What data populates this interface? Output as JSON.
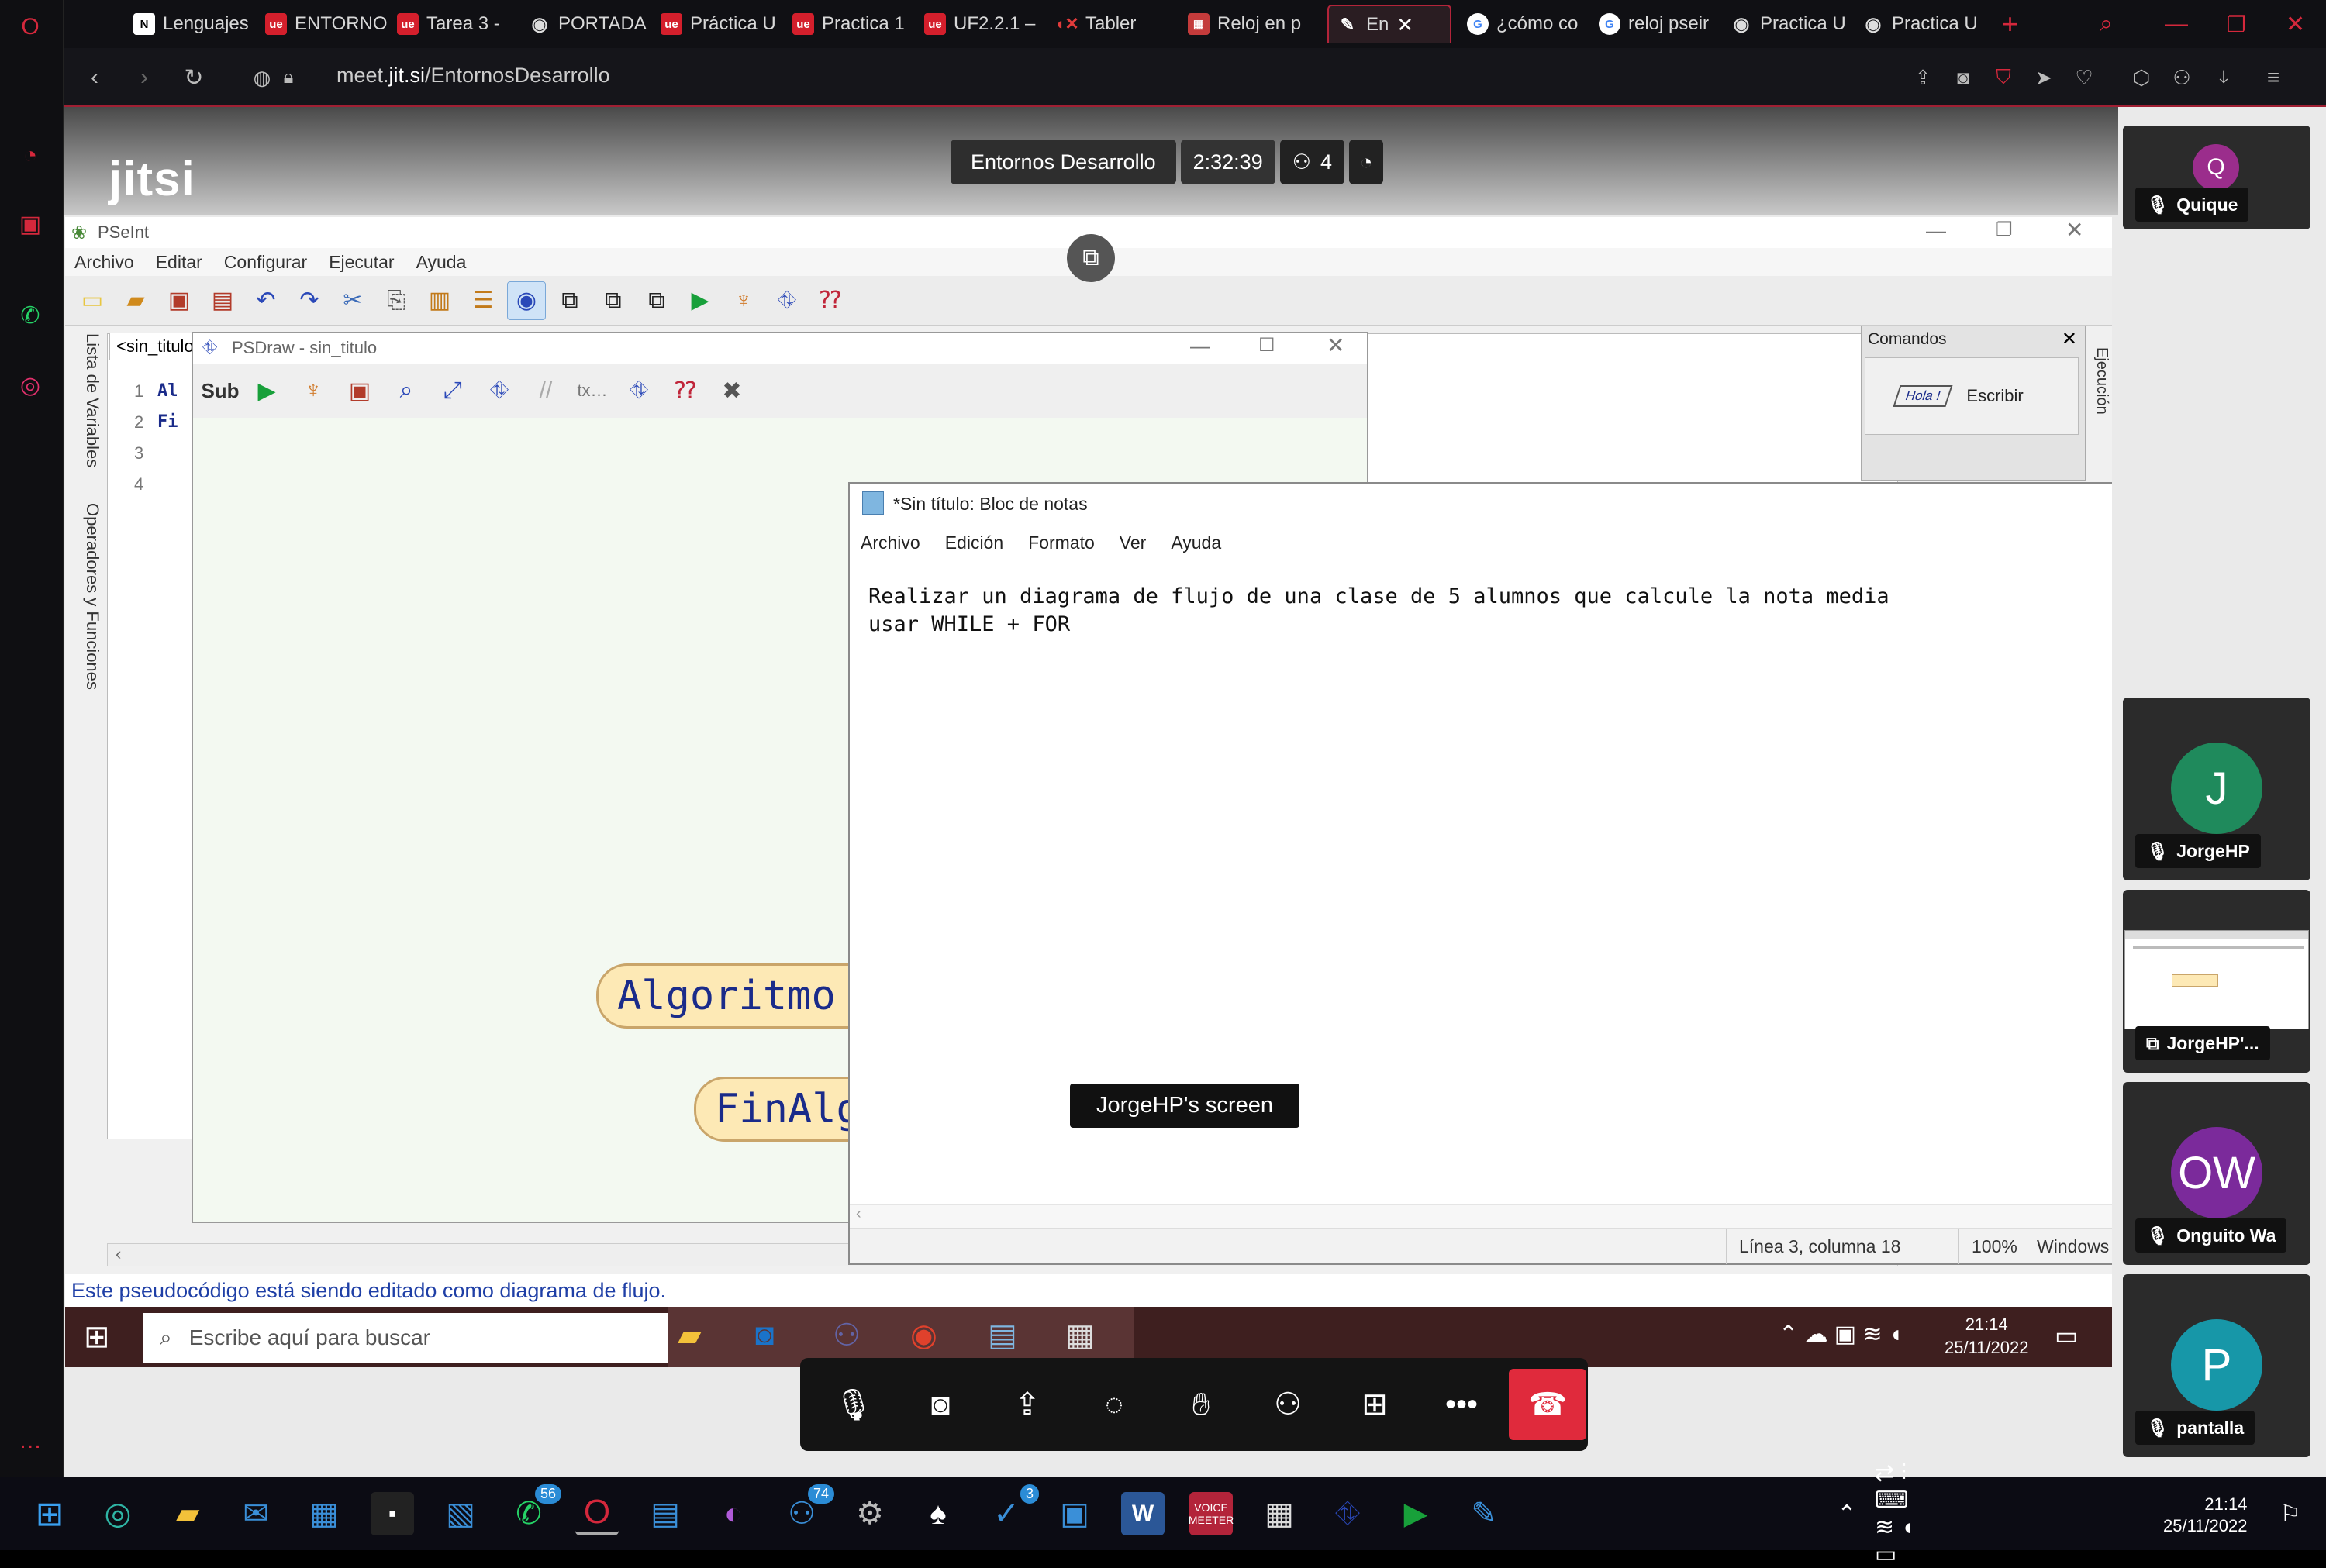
{
  "browser": {
    "tabs": [
      {
        "label": "Lenguajes",
        "icon": "notion-icon",
        "color": "#ffffff"
      },
      {
        "label": "ENTORNO",
        "icon": "ue-icon",
        "color": "#d41f2c"
      },
      {
        "label": "Tarea 3 -",
        "icon": "ue-icon",
        "color": "#d41f2c"
      },
      {
        "label": "PORTADA",
        "icon": "globe-icon",
        "color": "#dddddd"
      },
      {
        "label": "Práctica U",
        "icon": "ue-icon",
        "color": "#d41f2c"
      },
      {
        "label": "Practica 1",
        "icon": "ue-icon",
        "color": "#d41f2c"
      },
      {
        "label": "UF2.2.1 –",
        "icon": "ue-icon",
        "color": "#d41f2c"
      },
      {
        "label": "Tabler",
        "icon": "mute-icon",
        "color": "#f3c13a"
      },
      {
        "label": "Reloj en p",
        "icon": "app-icon",
        "color": "#c43b3b"
      },
      {
        "label": "En",
        "icon": "jitsi-icon",
        "color": "#ffffff"
      },
      {
        "label": "¿cómo co",
        "icon": "google-icon",
        "color": "#4285f4"
      },
      {
        "label": "reloj pseir",
        "icon": "google-icon",
        "color": "#4285f4"
      },
      {
        "label": "Practica U",
        "icon": "globe-icon",
        "color": "#dddddd"
      },
      {
        "label": "Practica U",
        "icon": "globe-icon",
        "color": "#dddddd"
      }
    ],
    "url_prefix": "meet.",
    "url_host": "jit.si",
    "url_path": "/EntornosDesarrollo"
  },
  "meeting": {
    "title": "Entornos Desarrollo",
    "timer": "2:32:39",
    "participants_count": "4",
    "logo": "jitsi",
    "participants": [
      {
        "initial": "Q",
        "name": "Quique",
        "color": "#9b2d8c"
      },
      {
        "initial": "J",
        "name": "JorgeHP",
        "color": "#1f8a5c"
      },
      {
        "initial": "",
        "name": "JorgeHP'...",
        "color": "#ffffff"
      },
      {
        "initial": "OW",
        "name": "Onguito Wa",
        "color": "#7b2a9b"
      },
      {
        "initial": "P",
        "name": "pantalla",
        "color": "#1797a8"
      }
    ],
    "screen_share_label": "JorgeHP's screen"
  },
  "pseint": {
    "title": "PSeInt",
    "menu": [
      "Archivo",
      "Editar",
      "Configurar",
      "Ejecutar",
      "Ayuda"
    ],
    "file_tab": "<sin_titulo",
    "line_numbers": [
      "1",
      "2",
      "3",
      "4"
    ],
    "code_fragments": [
      "Al",
      "",
      "Fi",
      ""
    ],
    "side_labels": [
      "Lista de Variables",
      "Operadores y Funciones"
    ],
    "commands_panel": {
      "title": "Comandos",
      "item": "Escribir",
      "item_graphic": "Hola !"
    },
    "exec_label": "Ejecución",
    "status": "Este pseudocódigo está siendo editado como diagrama de flujo."
  },
  "psdraw": {
    "title": "PSDraw - sin_titulo",
    "start_block": "Algoritmo sin_",
    "end_block": "FinAlgorit"
  },
  "notepad": {
    "title": "*Sin título: Bloc de notas",
    "menu": [
      "Archivo",
      "Edición",
      "Formato",
      "Ver",
      "Ayuda"
    ],
    "text": "Realizar un diagrama de flujo de una clase de 5 alumnos que calcule la nota media\nusar WHILE + FOR",
    "status_position": "Línea 3, columna 18",
    "status_zoom": "100%",
    "status_encoding": "Windows (CI"
  },
  "inner_taskbar": {
    "search_placeholder": "Escribe aquí para buscar",
    "time": "21:14",
    "date": "25/11/2022"
  },
  "taskbar": {
    "time": "21:14",
    "date": "25/11/2022",
    "badges": {
      "whatsapp": "56",
      "teams": "74",
      "todo": "3"
    },
    "voicemeeter_label": "VOICE MEETER"
  }
}
